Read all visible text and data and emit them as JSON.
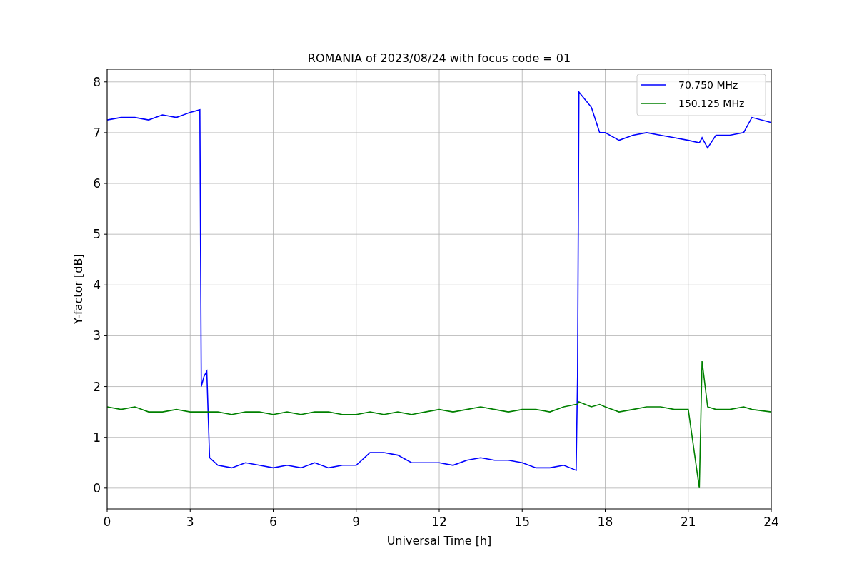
{
  "chart": {
    "chart_data": {
      "type": "line",
      "title": "ROMANIA of 2023/08/24 with focus code = 01",
      "xlabel": "Universal Time [h]",
      "ylabel": "Y-factor [dB]",
      "x": [
        0,
        0.5,
        1,
        1.5,
        2,
        2.5,
        3,
        3.35,
        3.4,
        3.5,
        3.6,
        3.7,
        4,
        4.5,
        5,
        5.5,
        6,
        6.5,
        7,
        7.5,
        8,
        8.5,
        9,
        9.5,
        10,
        10.5,
        11,
        11.5,
        12,
        12.5,
        13,
        13.5,
        14,
        14.5,
        15,
        15.5,
        16,
        16.5,
        16.95,
        17,
        17.05,
        17.5,
        17.8,
        18,
        18.5,
        19,
        19.5,
        20,
        20.5,
        21,
        21.4,
        21.5,
        21.7,
        22,
        22.5,
        23,
        23.3,
        24
      ],
      "series": [
        {
          "name": "70.750 MHz",
          "color": "#0000ff",
          "values": [
            7.25,
            7.3,
            7.3,
            7.25,
            7.35,
            7.3,
            7.4,
            7.45,
            2.0,
            2.2,
            2.3,
            0.6,
            0.45,
            0.4,
            0.5,
            0.45,
            0.4,
            0.45,
            0.4,
            0.5,
            0.4,
            0.45,
            0.45,
            0.7,
            0.7,
            0.65,
            0.5,
            0.5,
            0.5,
            0.45,
            0.55,
            0.6,
            0.55,
            0.55,
            0.5,
            0.4,
            0.4,
            0.45,
            0.35,
            2.2,
            7.8,
            7.5,
            7.0,
            7.0,
            6.85,
            6.95,
            7.0,
            6.95,
            6.9,
            6.85,
            6.8,
            6.9,
            6.7,
            6.95,
            6.95,
            7.0,
            7.3,
            7.2
          ]
        },
        {
          "name": "150.125 MHz",
          "color": "#008000",
          "values": [
            1.6,
            1.55,
            1.6,
            1.5,
            1.5,
            1.55,
            1.5,
            1.5,
            1.5,
            1.5,
            1.5,
            1.5,
            1.5,
            1.45,
            1.5,
            1.5,
            1.45,
            1.5,
            1.45,
            1.5,
            1.5,
            1.45,
            1.45,
            1.5,
            1.45,
            1.5,
            1.45,
            1.5,
            1.55,
            1.5,
            1.55,
            1.6,
            1.55,
            1.5,
            1.55,
            1.55,
            1.5,
            1.6,
            1.65,
            1.65,
            1.7,
            1.6,
            1.65,
            1.6,
            1.5,
            1.55,
            1.6,
            1.6,
            1.55,
            1.55,
            0.0,
            2.5,
            1.6,
            1.55,
            1.55,
            1.6,
            1.55,
            1.5
          ]
        }
      ],
      "xlim": [
        0,
        24
      ],
      "ylim": [
        -0.41,
        8.25
      ],
      "xticks": [
        0,
        3,
        6,
        9,
        12,
        15,
        18,
        21,
        24
      ],
      "yticks": [
        0,
        1,
        2,
        3,
        4,
        5,
        6,
        7,
        8
      ],
      "grid": true,
      "legend": "upper right"
    }
  }
}
